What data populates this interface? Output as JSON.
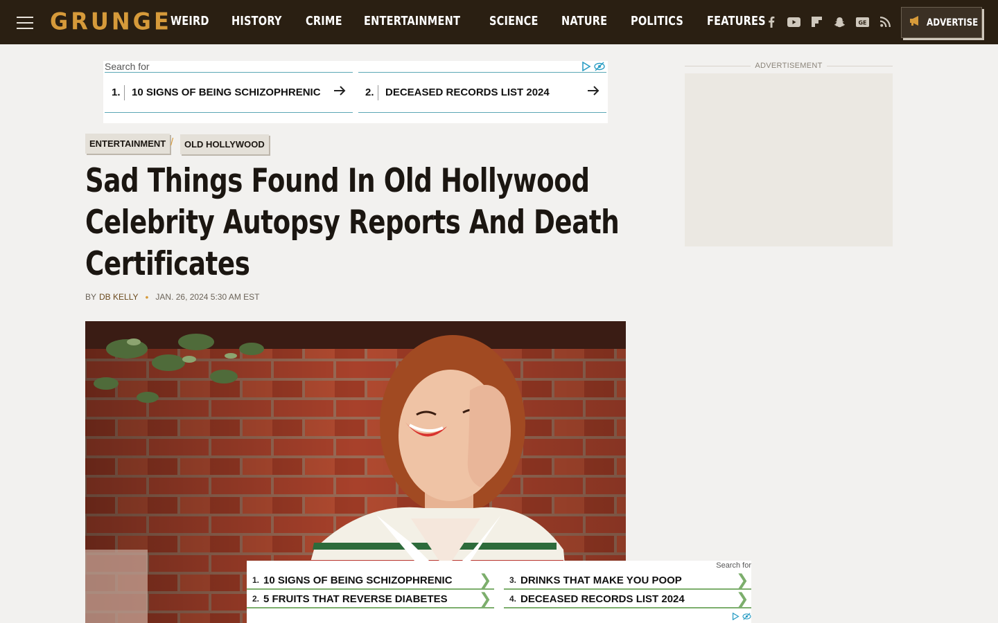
{
  "header": {
    "logo": "GRUNGE",
    "nav": [
      "WEIRD",
      "HISTORY",
      "CRIME",
      "ENTERTAINMENT",
      "SCIENCE",
      "NATURE",
      "POLITICS",
      "FEATURES"
    ],
    "social_icons": [
      "facebook-icon",
      "youtube-icon",
      "flipboard-icon",
      "snapchat-icon",
      "google-news-icon",
      "rss-icon"
    ],
    "advertise_label": "ADVERTISE",
    "brand_color": "#d69a3a",
    "bg_color": "#2a1f12"
  },
  "top_ad": {
    "search_label": "Search for",
    "links": [
      {
        "num": "1.",
        "text": "10 SIGNS OF BEING SCHIZOPHRENIC"
      },
      {
        "num": "2.",
        "text": "DECEASED RECORDS LIST 2024"
      }
    ]
  },
  "article": {
    "categories": [
      "ENTERTAINMENT",
      "OLD HOLLYWOOD"
    ],
    "category_separator": "/",
    "title": "Sad Things Found In Old Hollywood Celebrity Autopsy Reports And Death Certificates",
    "by_label": "BY",
    "author": "DB KELLY",
    "date": "JAN. 26, 2024 5:30 AM EST"
  },
  "sidebar": {
    "ad_label": "ADVERTISEMENT"
  },
  "bottom_ad": {
    "search_label": "Search for",
    "links": [
      {
        "num": "1.",
        "text": "10 SIGNS OF BEING SCHIZOPHRENIC"
      },
      {
        "num": "2.",
        "text": "5 FRUITS THAT REVERSE DIABETES"
      },
      {
        "num": "3.",
        "text": "DRINKS THAT MAKE YOU POOP"
      },
      {
        "num": "4.",
        "text": "DECEASED RECORDS LIST 2024"
      }
    ]
  }
}
